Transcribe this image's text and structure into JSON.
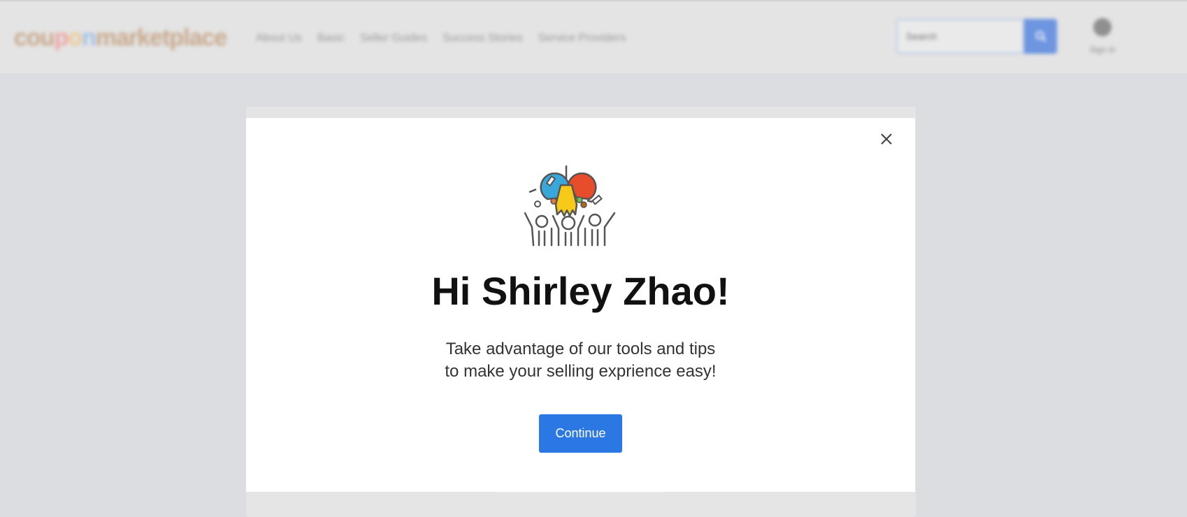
{
  "background": {
    "logo": {
      "parts": [
        "cou",
        "p",
        "o",
        "n",
        "marketplace"
      ]
    },
    "nav": [
      "About Us",
      "Basic",
      "Seller Guides",
      "Success Stories",
      "Service Providers"
    ],
    "search": {
      "placeholder": "Search"
    },
    "account": {
      "icon": "user-icon",
      "label": "Sign in"
    }
  },
  "modal": {
    "close_icon": "close-icon",
    "illustration_icon": "celebration-crowd-icon",
    "greeting": "Hi Shirley Zhao!",
    "subtitle_lines": [
      "Take advantage of our tools and tips",
      "to make your selling exprience easy!"
    ],
    "continue_label": "Continue"
  },
  "colors": {
    "overlay_background": "#dcdde1",
    "header_background": "#e4e4e4",
    "modal_background": "#ffffff",
    "primary_button": "#2b78e4",
    "heading_text": "#111111"
  }
}
